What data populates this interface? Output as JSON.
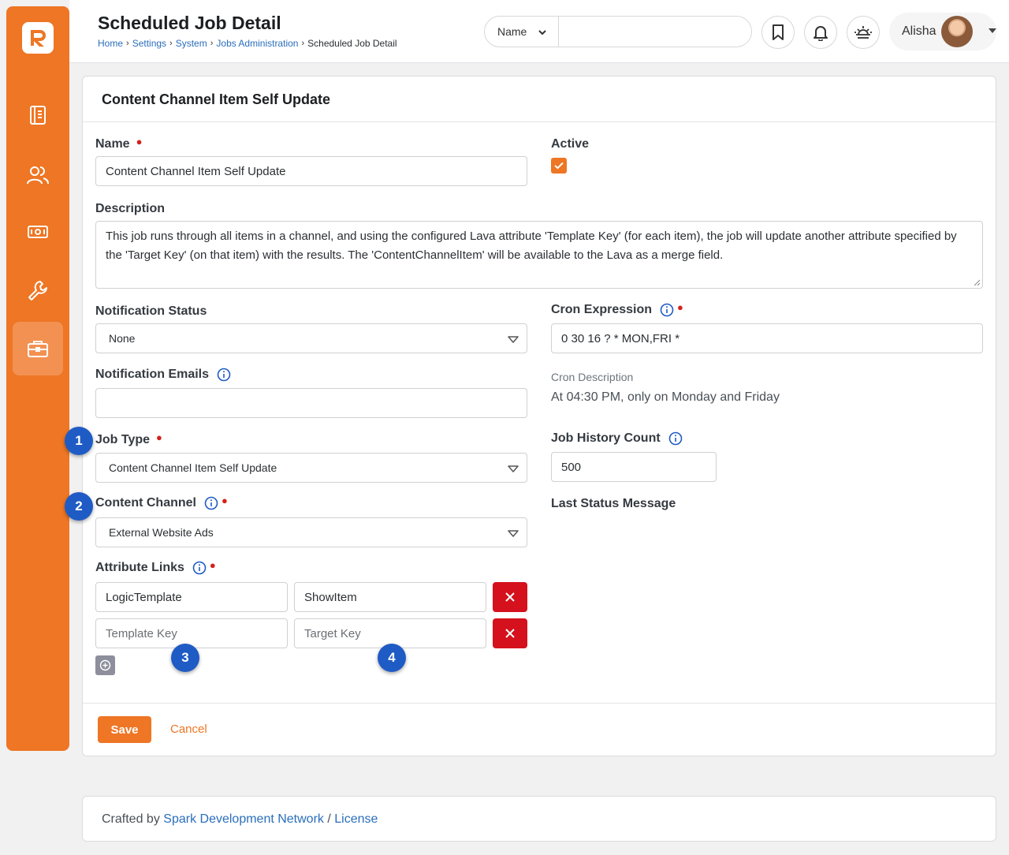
{
  "nav": {
    "items": [
      {
        "icon": "book-icon"
      },
      {
        "icon": "people-icon"
      },
      {
        "icon": "money-icon"
      },
      {
        "icon": "wrench-icon"
      },
      {
        "icon": "briefcase-icon",
        "active": true
      }
    ]
  },
  "header": {
    "title": "Scheduled Job Detail",
    "breadcrumb": [
      "Home",
      "Settings",
      "System",
      "Jobs Administration",
      "Scheduled Job Detail"
    ],
    "search": {
      "type": "Name",
      "value": ""
    },
    "user_name": "Alisha"
  },
  "card": {
    "title": "Content Channel Item Self Update",
    "name": {
      "label": "Name",
      "value": "Content Channel Item Self Update"
    },
    "active": {
      "label": "Active",
      "checked": true
    },
    "description": {
      "label": "Description",
      "value": "This job runs through all items in a channel, and using the configured Lava attribute 'Template Key' (for each item), the job will update another attribute specified by the 'Target Key' (on that item) with the results. The 'ContentChannelItem' will be available to the Lava as a merge field."
    },
    "notification_status": {
      "label": "Notification Status",
      "value": "None"
    },
    "cron_expression": {
      "label": "Cron Expression",
      "value": "0 30 16 ? * MON,FRI *"
    },
    "notification_emails": {
      "label": "Notification Emails",
      "value": ""
    },
    "cron_description": {
      "label": "Cron Description",
      "value": "At 04:30 PM, only on Monday and Friday"
    },
    "job_type": {
      "label": "Job Type",
      "value": "Content Channel Item Self Update"
    },
    "job_history_count": {
      "label": "Job History Count",
      "value": "500"
    },
    "content_channel": {
      "label": "Content Channel",
      "value": "External Website Ads"
    },
    "last_status_message": {
      "label": "Last Status Message"
    },
    "attribute_links": {
      "label": "Attribute Links",
      "rows": [
        {
          "template": "LogicTemplate",
          "target": "ShowItem"
        },
        {
          "template_placeholder": "Template Key",
          "target_placeholder": "Target Key"
        }
      ]
    },
    "save_label": "Save",
    "cancel_label": "Cancel"
  },
  "badges": [
    "1",
    "2",
    "3",
    "4"
  ],
  "footer": {
    "prefix": "Crafted by",
    "link1": "Spark Development Network",
    "sep": "/",
    "link2": "License"
  },
  "colors": {
    "brand": "#ee7624",
    "link": "#2a6ebb",
    "danger": "#d4111c",
    "badge": "#1f5bc4"
  }
}
